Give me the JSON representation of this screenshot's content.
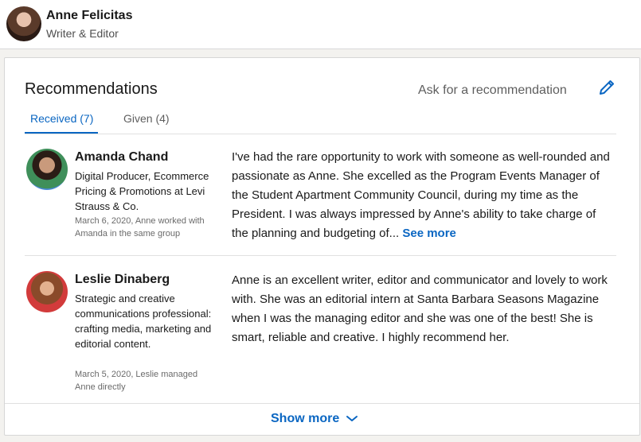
{
  "profile": {
    "name": "Anne Felicitas",
    "headline": "Writer & Editor"
  },
  "recommendations": {
    "title": "Recommendations",
    "ask_label": "Ask for a recommendation",
    "tabs": [
      {
        "label": "Received (7)",
        "active": true
      },
      {
        "label": "Given (4)",
        "active": false
      }
    ],
    "items": [
      {
        "name": "Amanda Chand",
        "headline": "Digital Producer, Ecommerce Pricing & Promotions at Levi Strauss & Co.",
        "meta": "March 6, 2020, Anne worked with Amanda in the same group",
        "text": "I've had the rare opportunity to work with someone as well-rounded and passionate as Anne. She excelled as the Program Events Manager of the Student Apartment Community Council, during my time as the President. I was always impressed by Anne's ability to take charge of the planning and budgeting of...",
        "see_more": "See more"
      },
      {
        "name": "Leslie Dinaberg",
        "headline": "Strategic and creative communications professional: crafting media, marketing and editorial content.",
        "meta": "March 5, 2020, Leslie managed Anne directly",
        "text": "Anne is an excellent writer, editor and communicator and lovely to work with. She was an editorial intern at Santa Barbara Seasons Magazine when I was the managing editor and she was one of the best! She is smart, reliable and creative. I highly recommend her."
      }
    ],
    "show_more": "Show more"
  },
  "colors": {
    "accent": "#0a66c2",
    "background": "#f3f2ef",
    "card": "#ffffff"
  },
  "icons": [
    "pencil-icon",
    "chevron-down-icon"
  ]
}
